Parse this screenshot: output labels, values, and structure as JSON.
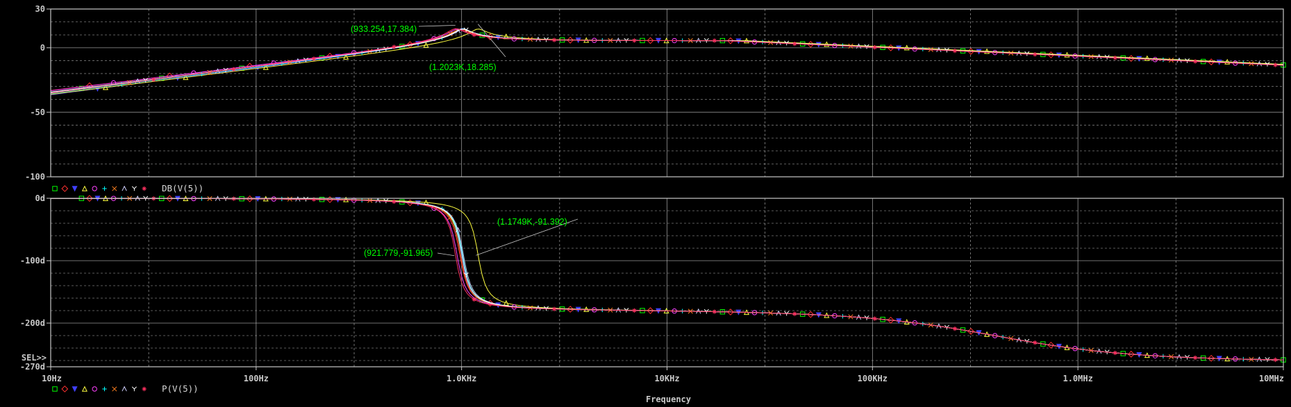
{
  "chart_data": [
    {
      "type": "line",
      "panel": "magnitude",
      "legend_label": "DB(V(5))",
      "ylim": [
        -100,
        30
      ],
      "y_ticks": [
        "30",
        "0",
        "-50",
        "-100"
      ],
      "y_tick_values": [
        30,
        0,
        -50,
        -100
      ],
      "x_scale": "log",
      "xlim": [
        10,
        10000000
      ],
      "grid": true,
      "series": [
        {
          "color": "#00ff00",
          "marker": "square",
          "f0": 1000,
          "scale": 1.0
        },
        {
          "color": "#ff3030",
          "marker": "diamond",
          "f0": 980,
          "scale": 0.97
        },
        {
          "color": "#4040ff",
          "marker": "triangle-down",
          "f0": 1000,
          "scale": 1.05
        },
        {
          "color": "#ffff40",
          "marker": "triangle",
          "f0": 1202.3,
          "scale": 1.0
        },
        {
          "color": "#ff40ff",
          "marker": "circle",
          "f0": 950,
          "scale": 0.98
        },
        {
          "color": "#00ffff",
          "marker": "plus",
          "f0": 1010,
          "scale": 1.02
        },
        {
          "color": "#ff8020",
          "marker": "x",
          "f0": 990,
          "scale": 1.01
        },
        {
          "color": "#d0d0ff",
          "marker": "lambda",
          "f0": 1020,
          "scale": 0.99
        },
        {
          "color": "#ffffff",
          "marker": "y",
          "f0": 1005,
          "scale": 1.0
        },
        {
          "color": "#ff3060",
          "marker": "star",
          "f0": 933.254,
          "scale": 1.03
        }
      ],
      "annotations": [
        {
          "text": "(933.254,17.384)",
          "x": 933.254,
          "y": 17.384
        },
        {
          "text": "(1.2023K,18.285)",
          "x": 1202.3,
          "y": 18.285
        }
      ]
    },
    {
      "type": "line",
      "panel": "phase",
      "legend_label": "P(V(5))",
      "ylim": [
        -270,
        0
      ],
      "y_ticks": [
        "0d",
        "-100d",
        "-200d",
        "-270d"
      ],
      "y_tick_values": [
        0,
        -100,
        -200,
        -270
      ],
      "sel_marker": "SEL>>",
      "x_scale": "log",
      "xlim": [
        10,
        10000000
      ],
      "grid": true,
      "annotations": [
        {
          "text": "(1.1749K,-91.392)",
          "x": 1174.9,
          "y": -91.392
        },
        {
          "text": "(921.779,-91.965)",
          "x": 921.779,
          "y": -91.965
        }
      ]
    }
  ],
  "x_axis": {
    "label": "Frequency",
    "ticks": [
      "10Hz",
      "100Hz",
      "1.0KHz",
      "10KHz",
      "100KHz",
      "1.0MHz",
      "10MHz"
    ],
    "tick_values": [
      10,
      100,
      1000,
      10000,
      100000,
      1000000,
      10000000
    ]
  },
  "colors": {
    "background": "#000000",
    "frame": "#c8c8c8",
    "grid": "#c8c8c8",
    "annotation": "#00ff00",
    "text": "#d8d8d8"
  }
}
